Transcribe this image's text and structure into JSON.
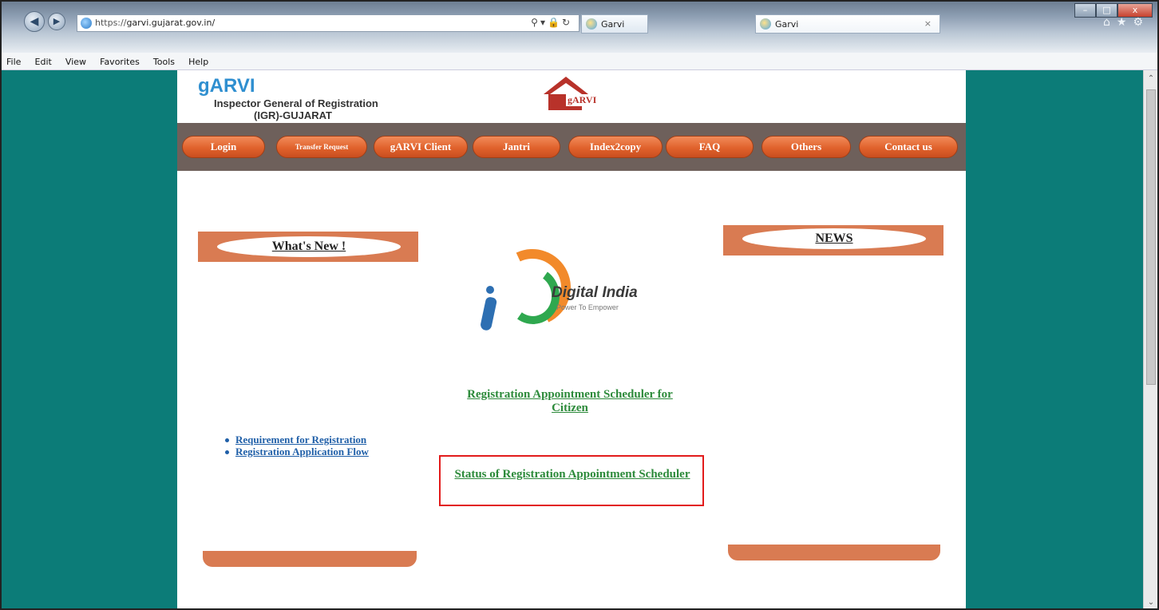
{
  "browser": {
    "url_prefix": "https://",
    "url_host": "garvi.gujarat.gov.in/",
    "tab1_title": "Garvi",
    "tab2_title": "Garvi",
    "tab2_close": "×",
    "menu": [
      "File",
      "Edit",
      "View",
      "Favorites",
      "Tools",
      "Help"
    ],
    "icons": [
      "back-icon",
      "forward-icon",
      "search-icon",
      "lock-icon",
      "refresh-icon",
      "home-icon",
      "star-icon",
      "gear-icon"
    ]
  },
  "site": {
    "brand_title": "gARVI",
    "brand_sub1": "Inspector General of Registration",
    "brand_sub2": "(IGR)-GUJARAT",
    "logo_text": "gARVI"
  },
  "nav": [
    {
      "label": "Login"
    },
    {
      "label": "Transfer Request"
    },
    {
      "label": "gARVI Client"
    },
    {
      "label": "Jantri"
    },
    {
      "label": "Index2copy"
    },
    {
      "label": "FAQ"
    },
    {
      "label": "Others"
    },
    {
      "label": "Contact us"
    }
  ],
  "whats_new": {
    "title": "What's New !"
  },
  "news": {
    "title": "NEWS"
  },
  "digital_india": {
    "title": "Digital India",
    "tagline": "Power To Empower"
  },
  "links": {
    "appointment": "Registration Appointment Scheduler for Citizen",
    "status": "Status of Registration Appointment Scheduler"
  },
  "req_list": [
    "Requirement for Registration",
    "Registration Application Flow"
  ],
  "colors": {
    "teal": "#0c7c78",
    "orange": "#d97b52",
    "link_green": "#2c8a3a",
    "highlight": "#e21b1b"
  }
}
